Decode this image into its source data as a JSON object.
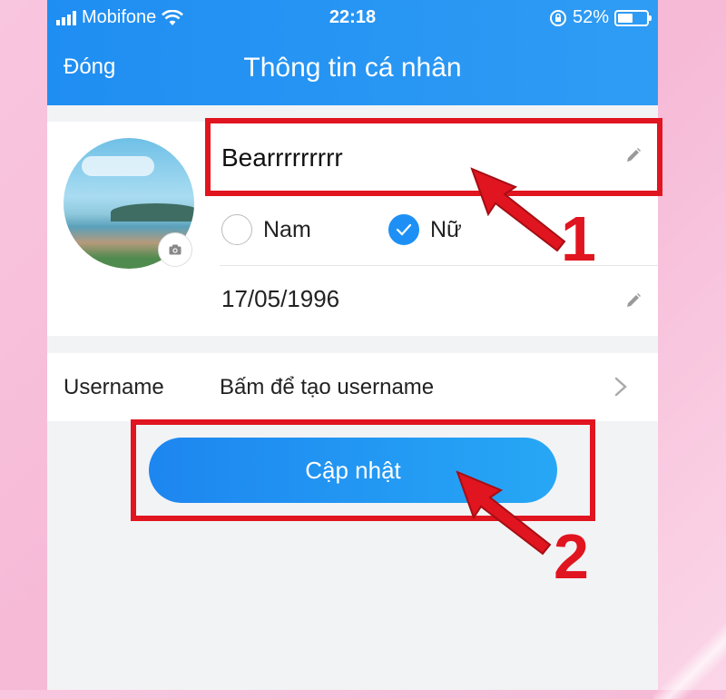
{
  "status_bar": {
    "carrier": "Mobifone",
    "time": "22:18",
    "battery": "52%",
    "battery_level": 0.52
  },
  "header": {
    "close_label": "Đóng",
    "title": "Thông tin cá nhân"
  },
  "profile": {
    "name_value": "Bearrrrrrrrr",
    "gender_options": [
      {
        "label": "Nam",
        "selected": false
      },
      {
        "label": "Nữ",
        "selected": true
      }
    ],
    "dob": "17/05/1996"
  },
  "username": {
    "label": "Username",
    "value": "Bấm để tạo username"
  },
  "update_button": {
    "label": "Cập nhật"
  },
  "annotations": {
    "step1": "1",
    "step2": "2",
    "color": "#e0151f"
  },
  "colors": {
    "header_blue": "#2196f3",
    "button_blue": "#1e90f5",
    "highlight_red": "#e0151f"
  }
}
